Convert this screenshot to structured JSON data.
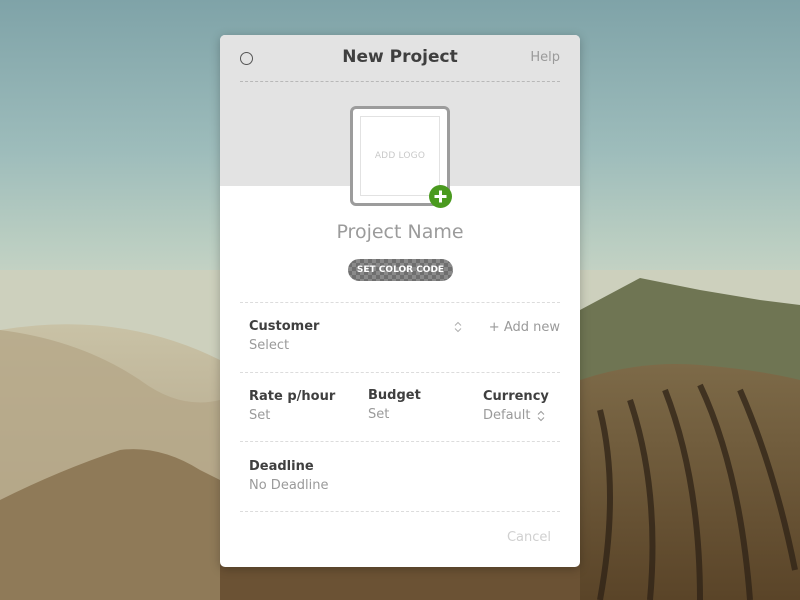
{
  "modal": {
    "title": "New Project",
    "help_label": "Help",
    "logo": {
      "placeholder": "ADD LOGO",
      "add_icon": "plus-icon"
    },
    "project_name_placeholder": "Project Name",
    "color_code_label": "SET COLOR CODE",
    "customer": {
      "label": "Customer",
      "value": "Select",
      "add_new_label": "+ Add new",
      "stepper_icon": "chevron-updown-icon"
    },
    "rate": {
      "label": "Rate p/hour",
      "value": "Set"
    },
    "budget": {
      "label": "Budget",
      "value": "Set"
    },
    "currency": {
      "label": "Currency",
      "value": "Default",
      "stepper_icon": "chevron-updown-icon"
    },
    "deadline": {
      "label": "Deadline",
      "value": "No Deadline"
    },
    "cancel_label": "Cancel"
  },
  "colors": {
    "accent_green": "#4a9a1f",
    "header_bg": "#e3e3e3",
    "label_text": "#3f3f3f",
    "muted_text": "#9a9a9a"
  }
}
